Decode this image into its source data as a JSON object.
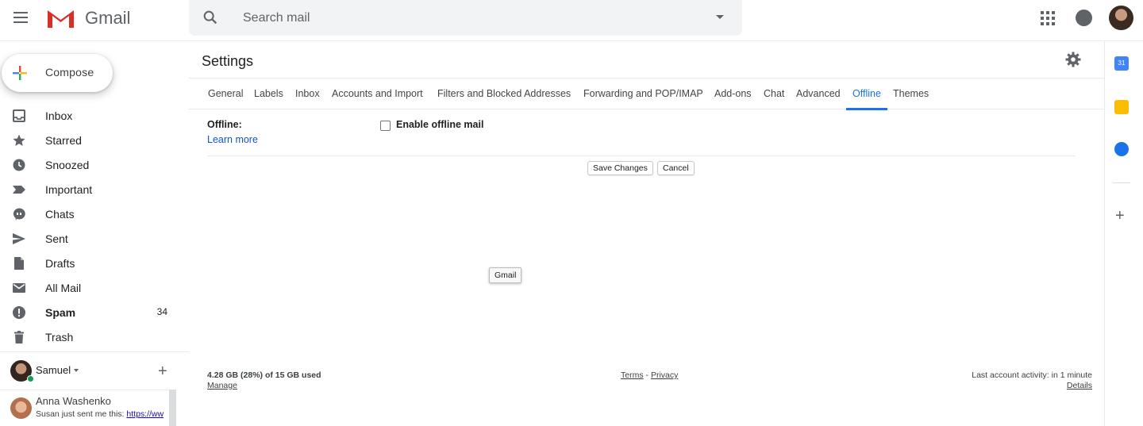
{
  "header": {
    "app_name": "Gmail",
    "search_placeholder": "Search mail"
  },
  "compose_label": "Compose",
  "nav": [
    {
      "label": "Inbox",
      "icon": "inbox-icon",
      "bold": false,
      "count": ""
    },
    {
      "label": "Starred",
      "icon": "star-icon",
      "bold": false,
      "count": ""
    },
    {
      "label": "Snoozed",
      "icon": "clock-icon",
      "bold": false,
      "count": ""
    },
    {
      "label": "Important",
      "icon": "important-icon",
      "bold": false,
      "count": ""
    },
    {
      "label": "Chats",
      "icon": "chat-icon",
      "bold": false,
      "count": ""
    },
    {
      "label": "Sent",
      "icon": "send-icon",
      "bold": false,
      "count": ""
    },
    {
      "label": "Drafts",
      "icon": "draft-icon",
      "bold": false,
      "count": ""
    },
    {
      "label": "All Mail",
      "icon": "mail-icon",
      "bold": false,
      "count": ""
    },
    {
      "label": "Spam",
      "icon": "spam-icon",
      "bold": true,
      "count": "34"
    },
    {
      "label": "Trash",
      "icon": "trash-icon",
      "bold": false,
      "count": ""
    }
  ],
  "hangouts": {
    "user_name": "Samuel",
    "contact_name": "Anna Washenko",
    "contact_message_prefix": "Susan just sent me this: ",
    "contact_message_link": "https://ww"
  },
  "settings": {
    "title": "Settings",
    "tabs": [
      "General",
      "Labels",
      "Inbox",
      "Accounts and Import",
      "Filters and Blocked Addresses",
      "Forwarding and POP/IMAP",
      "Add-ons",
      "Chat",
      "Advanced",
      "Offline",
      "Themes"
    ],
    "active_tab": "Offline",
    "offline_label": "Offline:",
    "learn_more": "Learn more",
    "enable_offline_label": "Enable offline mail",
    "save_button": "Save Changes",
    "cancel_button": "Cancel",
    "tooltip": "Gmail"
  },
  "footer": {
    "usage": "4.28 GB (28%) of 15 GB used",
    "manage": "Manage",
    "terms": "Terms",
    "separator": " - ",
    "privacy": "Privacy",
    "last_activity": "Last account activity: in 1 minute",
    "details": "Details"
  },
  "side_panel": {
    "calendar_day": "31"
  },
  "colors": {
    "accent": "#1a73e8",
    "link": "#1155cc",
    "online": "#0f9d58"
  }
}
